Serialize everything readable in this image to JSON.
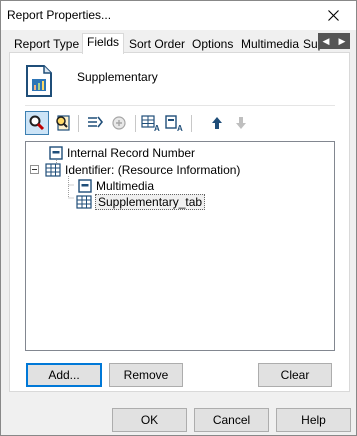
{
  "window": {
    "title": "Report Properties..."
  },
  "tabs": [
    {
      "label": "Report Type"
    },
    {
      "label": "Fields",
      "active": true
    },
    {
      "label": "Sort Order"
    },
    {
      "label": "Options"
    },
    {
      "label": "Multimedia"
    },
    {
      "label": "Sup"
    }
  ],
  "section": {
    "label": "Supplementary",
    "icon": "report-document-icon"
  },
  "toolbar": {
    "icons": [
      "field-search-icon",
      "field-list-icon",
      "indent-icon",
      "add-circle-icon",
      "table-a-icon",
      "field-a-icon",
      "move-up-icon",
      "move-down-icon"
    ]
  },
  "tree": {
    "items": [
      {
        "label": "Internal Record Number",
        "icon": "field-icon"
      },
      {
        "label": "Identifier: (Resource Information)",
        "icon": "table-icon",
        "expanded": true
      },
      {
        "label": "Multimedia",
        "icon": "field-icon"
      },
      {
        "label": "Supplementary_tab",
        "icon": "table-icon",
        "selected": true
      }
    ]
  },
  "panel_buttons": {
    "add": "Add...",
    "remove": "Remove",
    "clear": "Clear"
  },
  "dialog_buttons": {
    "ok": "OK",
    "cancel": "Cancel",
    "help": "Help"
  },
  "colors": {
    "accent": "#0078d7",
    "selection": "#cce4f7",
    "icon_blue": "#1f4e79"
  }
}
